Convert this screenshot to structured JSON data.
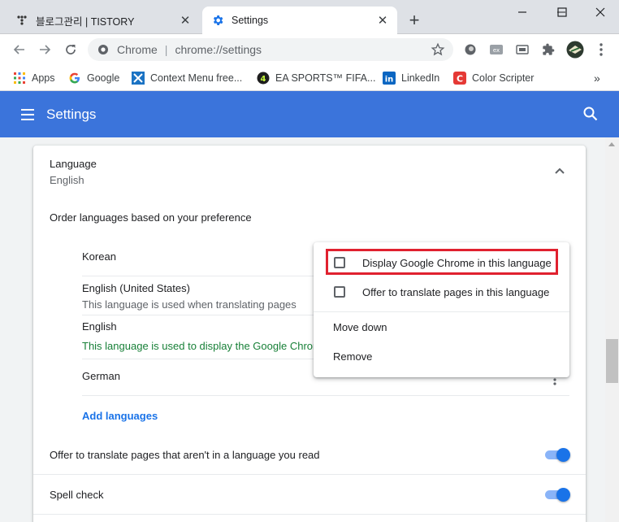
{
  "tabs": [
    {
      "title": "블로그관리 | TISTORY",
      "favicon": "tistory-icon",
      "active": false
    },
    {
      "title": "Settings",
      "favicon": "settings-gear-icon",
      "active": true
    }
  ],
  "toolbar": {
    "omnibox_chip": "Chrome",
    "omnibox_separator": "|",
    "url": "chrome://settings"
  },
  "bookmarks": [
    {
      "label": "Apps",
      "icon": "apps-grid-icon"
    },
    {
      "label": "Google",
      "icon": "google-icon"
    },
    {
      "label": "Context Menu free...",
      "icon": "context-menu-icon"
    },
    {
      "label": "EA SPORTS™ FIFA...",
      "icon": "fifa-icon"
    },
    {
      "label": "LinkedIn",
      "icon": "linkedin-icon"
    },
    {
      "label": "Color Scripter",
      "icon": "color-scripter-icon"
    }
  ],
  "header": {
    "title": "Settings"
  },
  "language": {
    "heading": "Language",
    "current": "English",
    "order_label": "Order languages based on your preference",
    "languages": [
      {
        "name": "Korean",
        "note": ""
      },
      {
        "name": "English (United States)",
        "note": "This language is used when translating pages"
      },
      {
        "name": "English",
        "note": "This language is used to display the Google Chrom"
      },
      {
        "name": "German",
        "note": ""
      }
    ],
    "add_languages": "Add languages",
    "offer_translate": "Offer to translate pages that aren't in a language you read",
    "offer_translate_on": true,
    "spell_check": "Spell check",
    "spell_check_on": true
  },
  "context_menu": {
    "display_in_language": "Display Google Chrome in this language",
    "display_checked": false,
    "offer_translate": "Offer to translate pages in this language",
    "offer_checked": false,
    "move_down": "Move down",
    "remove": "Remove"
  },
  "colors": {
    "header_blue": "#3b74db",
    "accent_blue": "#1a73e8",
    "note_green": "#188038",
    "highlight_red": "#e0212f"
  }
}
